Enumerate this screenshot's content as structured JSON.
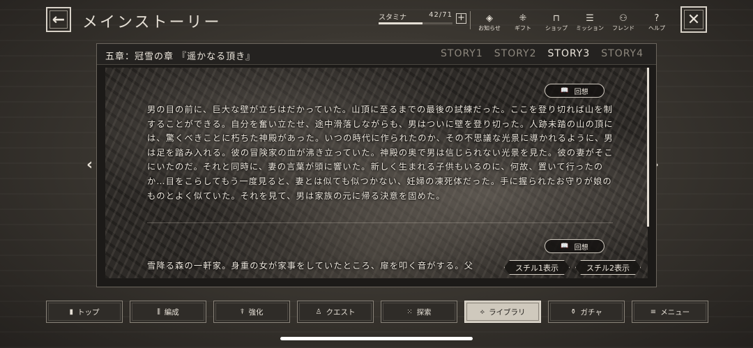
{
  "header": {
    "title": "メインストーリー",
    "stamina": {
      "label": "スタミナ",
      "value": "42/71",
      "fraction": 0.59
    },
    "menu": [
      {
        "icon": "notice-icon",
        "glyph": "◈",
        "label": "お知らせ"
      },
      {
        "icon": "gift-icon",
        "glyph": "⁜",
        "label": "ギフト"
      },
      {
        "icon": "shop-icon",
        "glyph": "⊓",
        "label": "ショップ"
      },
      {
        "icon": "mission-icon",
        "glyph": "☰",
        "label": "ミッション"
      },
      {
        "icon": "friend-icon",
        "glyph": "⚇",
        "label": "フレンド"
      },
      {
        "icon": "help-icon",
        "glyph": "?",
        "label": "ヘルプ"
      }
    ]
  },
  "panel": {
    "chapter": "五章：冠雪の章 『遥かなる頂き』",
    "tabs": [
      "STORY1",
      "STORY2",
      "STORY3",
      "STORY4"
    ],
    "active_tab": 2,
    "recall_label": "回想",
    "story1_text": "男の目の前に、巨大な壁が立ちはだかっていた。山頂に至るまでの最後の試練だった。ここを登り切れば山を制することができる。自分を奮い立たせ、途中滑落しながらも、男はついに壁を登り切った。人跡未踏の山の頂には、驚くべきことに朽ちた神殿があった。いつの時代に作られたのか、その不思議な光景に導かれるように、男は足を踏み入れる。彼の冒険家の血が沸き立っていた。神殿の奥で男は信じられない光景を見た。彼の妻がそこにいたのだ。それと同時に、妻の言葉が頭に響いた。新しく生まれる子供もいるのに、何故、置いて行ったのか…目をこらしてもう一度見ると、妻とは似ても似つかない、妊婦の凍死体だった。手に握られたお守りが娘のものとよく似ていた。それを見て、男は家族の元に帰る決意を固めた。",
    "story2_text": "雪降る森の一軒家。身重の女が家事をしていたところ、扉を叩く音がする。父",
    "still1_label": "スチル1表示",
    "still2_label": "スチル2表示"
  },
  "nav": [
    {
      "icon": "top-icon",
      "glyph": "▮",
      "label": "トップ"
    },
    {
      "icon": "formation-icon",
      "glyph": "⫼",
      "label": "編成"
    },
    {
      "icon": "enhance-icon",
      "glyph": "⍒",
      "label": "強化"
    },
    {
      "icon": "quest-icon",
      "glyph": "♙",
      "label": "クエスト"
    },
    {
      "icon": "explore-icon",
      "glyph": "⁙",
      "label": "探索"
    },
    {
      "icon": "library-icon",
      "glyph": "⟡",
      "label": "ライブラリ"
    },
    {
      "icon": "gacha-icon",
      "glyph": "⚱",
      "label": "ガチャ"
    },
    {
      "icon": "menu-icon",
      "glyph": "≡",
      "label": "メニュー"
    }
  ],
  "nav_active": 5
}
